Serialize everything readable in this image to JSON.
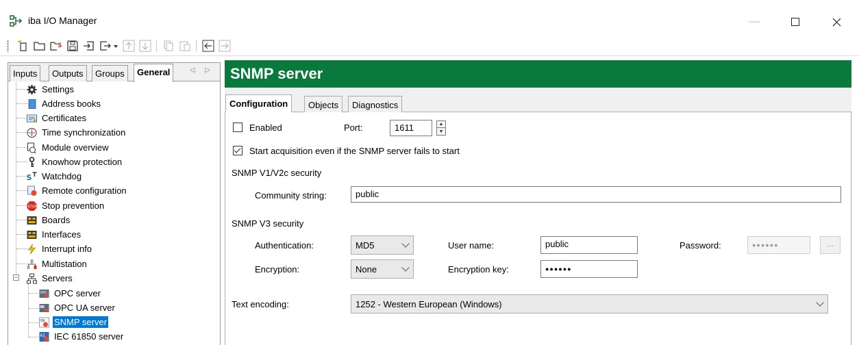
{
  "window": {
    "title": "iba I/O Manager",
    "controls": {
      "minimize": "—",
      "maximize": "☐",
      "close": "✕"
    }
  },
  "toolbar": {
    "buttons": [
      "new-icon",
      "open-folder-icon",
      "open-config-icon",
      "save-icon",
      "import-icon",
      "export-icon",
      "move-up-icon",
      "move-down-icon",
      "copy-icon",
      "paste-icon",
      "back-icon",
      "forward-icon"
    ]
  },
  "left_tabs": {
    "items": [
      {
        "label": "Inputs"
      },
      {
        "label": "Outputs"
      },
      {
        "label": "Groups"
      },
      {
        "label": "General",
        "active": true
      }
    ],
    "scroll_arrows": "◁ ▷"
  },
  "tree": {
    "items": [
      {
        "label": "Settings",
        "icon": "gear-icon"
      },
      {
        "label": "Address books",
        "icon": "address-book-icon"
      },
      {
        "label": "Certificates",
        "icon": "certificate-icon"
      },
      {
        "label": "Time synchronization",
        "icon": "clock-sync-icon"
      },
      {
        "label": "Module overview",
        "icon": "module-overview-icon"
      },
      {
        "label": "Knowhow protection",
        "icon": "key-icon"
      },
      {
        "label": "Watchdog",
        "icon": "watchdog-icon"
      },
      {
        "label": "Remote configuration",
        "icon": "remote-config-icon"
      },
      {
        "label": "Stop prevention",
        "icon": "stop-icon"
      },
      {
        "label": "Boards",
        "icon": "board-icon"
      },
      {
        "label": "Interfaces",
        "icon": "interface-icon"
      },
      {
        "label": "Interrupt info",
        "icon": "lightning-icon"
      },
      {
        "label": "Multistation",
        "icon": "multistation-icon"
      },
      {
        "label": "Servers",
        "icon": "servers-icon",
        "expander": "−"
      },
      {
        "label": "OPC server",
        "icon": "opc-icon"
      },
      {
        "label": "OPC UA server",
        "icon": "opc-ua-icon"
      },
      {
        "label": "SNMP server",
        "icon": "snmp-icon",
        "selected": true
      },
      {
        "label": "IEC 61850 server",
        "icon": "iec-icon"
      }
    ]
  },
  "panel": {
    "title": "SNMP server",
    "accent": "#097a3c",
    "tabs": [
      {
        "label": "Configuration",
        "active": true
      },
      {
        "label": "Objects"
      },
      {
        "label": "Diagnostics"
      }
    ]
  },
  "config": {
    "enabled_label": "Enabled",
    "enabled_checked": false,
    "port_label": "Port:",
    "port_value": "1611",
    "start_acq_label": "Start acquisition even if the SNMP server fails to start",
    "start_acq_checked": true,
    "v1_section": "SNMP V1/V2c security",
    "community_label": "Community string:",
    "community_value": "public",
    "v3_section": "SNMP V3 security",
    "auth_label": "Authentication:",
    "auth_value": "MD5",
    "user_label": "User name:",
    "user_value": "public",
    "password_label": "Password:",
    "password_value": "●●●●●●",
    "password_button": "...",
    "enc_label": "Encryption:",
    "enc_value": "None",
    "enc_key_label": "Encryption key:",
    "enc_key_value": "●●●●●●",
    "text_enc_label": "Text encoding:",
    "text_enc_value": "1252 - Western European (Windows)"
  }
}
